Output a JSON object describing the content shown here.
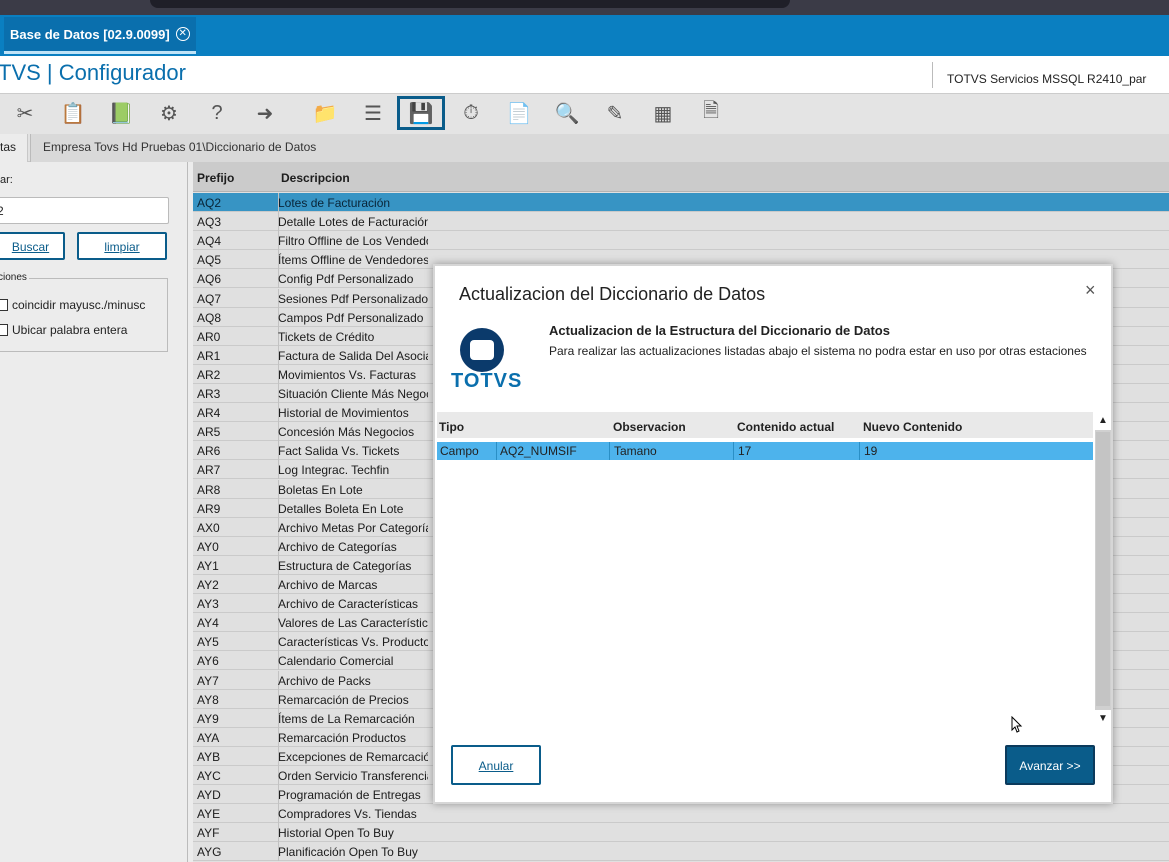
{
  "tab": {
    "title": "Base de Datos [02.9.0099]"
  },
  "app": {
    "title": "TVS | Configurador",
    "server": "TOTVS Servicios MSSQL R2410_par"
  },
  "toolbar": {
    "icons": [
      "scissors-icon",
      "clipboard-icon",
      "book-icon",
      "tools-icon",
      "help-icon",
      "exit-icon",
      "folder-icon",
      "list-icon",
      "save-icon",
      "clock-icon",
      "add-doc-icon",
      "search-doc-icon",
      "edit-icon",
      "table-icon",
      "page-icon"
    ]
  },
  "crumbs": {
    "tab_label": "tas",
    "path": "Empresa Tovs Hd Pruebas 01\\Diccionario de Datos"
  },
  "left": {
    "search_label": "ar:",
    "search_value": "2",
    "buscar": "Buscar",
    "limpiar": "limpiar",
    "options_label": "ciones",
    "opt1": "coincidir mayusc./minusc",
    "opt2": "Ubicar palabra entera"
  },
  "grid": {
    "col_prefix": "Prefijo",
    "col_desc": "Descripcion",
    "rows": [
      [
        "AQ2",
        "Lotes de Facturación"
      ],
      [
        "AQ3",
        "Detalle Lotes de Facturación"
      ],
      [
        "AQ4",
        "Filtro Offline de Los Vendedor"
      ],
      [
        "AQ5",
        "Ítems Offline de Vendedores"
      ],
      [
        "AQ6",
        "Config Pdf Personalizado"
      ],
      [
        "AQ7",
        "Sesiones Pdf Personalizado"
      ],
      [
        "AQ8",
        "Campos Pdf Personalizado"
      ],
      [
        "AR0",
        "Tickets de Crédito"
      ],
      [
        "AR1",
        "Factura de Salida Del Asociado"
      ],
      [
        "AR2",
        "Movimientos Vs. Facturas"
      ],
      [
        "AR3",
        "Situación Cliente Más Negocios"
      ],
      [
        "AR4",
        "Historial de Movimientos"
      ],
      [
        "AR5",
        "Concesión Más Negocios"
      ],
      [
        "AR6",
        "Fact Salida Vs. Tickets"
      ],
      [
        "AR7",
        "Log Integrac. Techfin"
      ],
      [
        "AR8",
        "Boletas En Lote"
      ],
      [
        "AR9",
        "Detalles Boleta En Lote"
      ],
      [
        "AX0",
        "Archivo Metas Por Categoría"
      ],
      [
        "AY0",
        "Archivo de Categorías"
      ],
      [
        "AY1",
        "Estructura de Categorías"
      ],
      [
        "AY2",
        "Archivo de Marcas"
      ],
      [
        "AY3",
        "Archivo de Características"
      ],
      [
        "AY4",
        "Valores de Las Características"
      ],
      [
        "AY5",
        "Características Vs. Productos"
      ],
      [
        "AY6",
        "Calendario Comercial"
      ],
      [
        "AY7",
        "Archivo de Packs"
      ],
      [
        "AY8",
        "Remarcación de Precios"
      ],
      [
        "AY9",
        "Ítems de La Remarcación"
      ],
      [
        "AYA",
        "Remarcación Productos"
      ],
      [
        "AYB",
        "Excepciones de Remarcación"
      ],
      [
        "AYC",
        "Orden Servicio Transferencia"
      ],
      [
        "AYD",
        "Programación de Entregas"
      ],
      [
        "AYE",
        "Compradores Vs. Tiendas"
      ],
      [
        "AYF",
        "Historial Open To Buy"
      ],
      [
        "AYG",
        "Planificación Open To Buy"
      ]
    ]
  },
  "modal": {
    "title": "Actualizacion del Diccionario de Datos",
    "close": "×",
    "logo_text": "TOTVS",
    "heading": "Actualizacion de la Estructura del Diccionario de Datos",
    "subheading": "Para realizar las actualizaciones listadas abajo el sistema no podra estar en uso por otras estaciones",
    "table": {
      "col_tipo": "Tipo",
      "col_obs": "Observacion",
      "col_actual": "Contenido actual",
      "col_nuevo": "Nuevo Contenido",
      "row": {
        "tipo": "Campo",
        "campo": "AQ2_NUMSIF",
        "obs": "Tamano",
        "actual": "17",
        "nuevo": "19"
      }
    },
    "btn_cancel": "Anular",
    "btn_next": "Avanzar >>"
  }
}
